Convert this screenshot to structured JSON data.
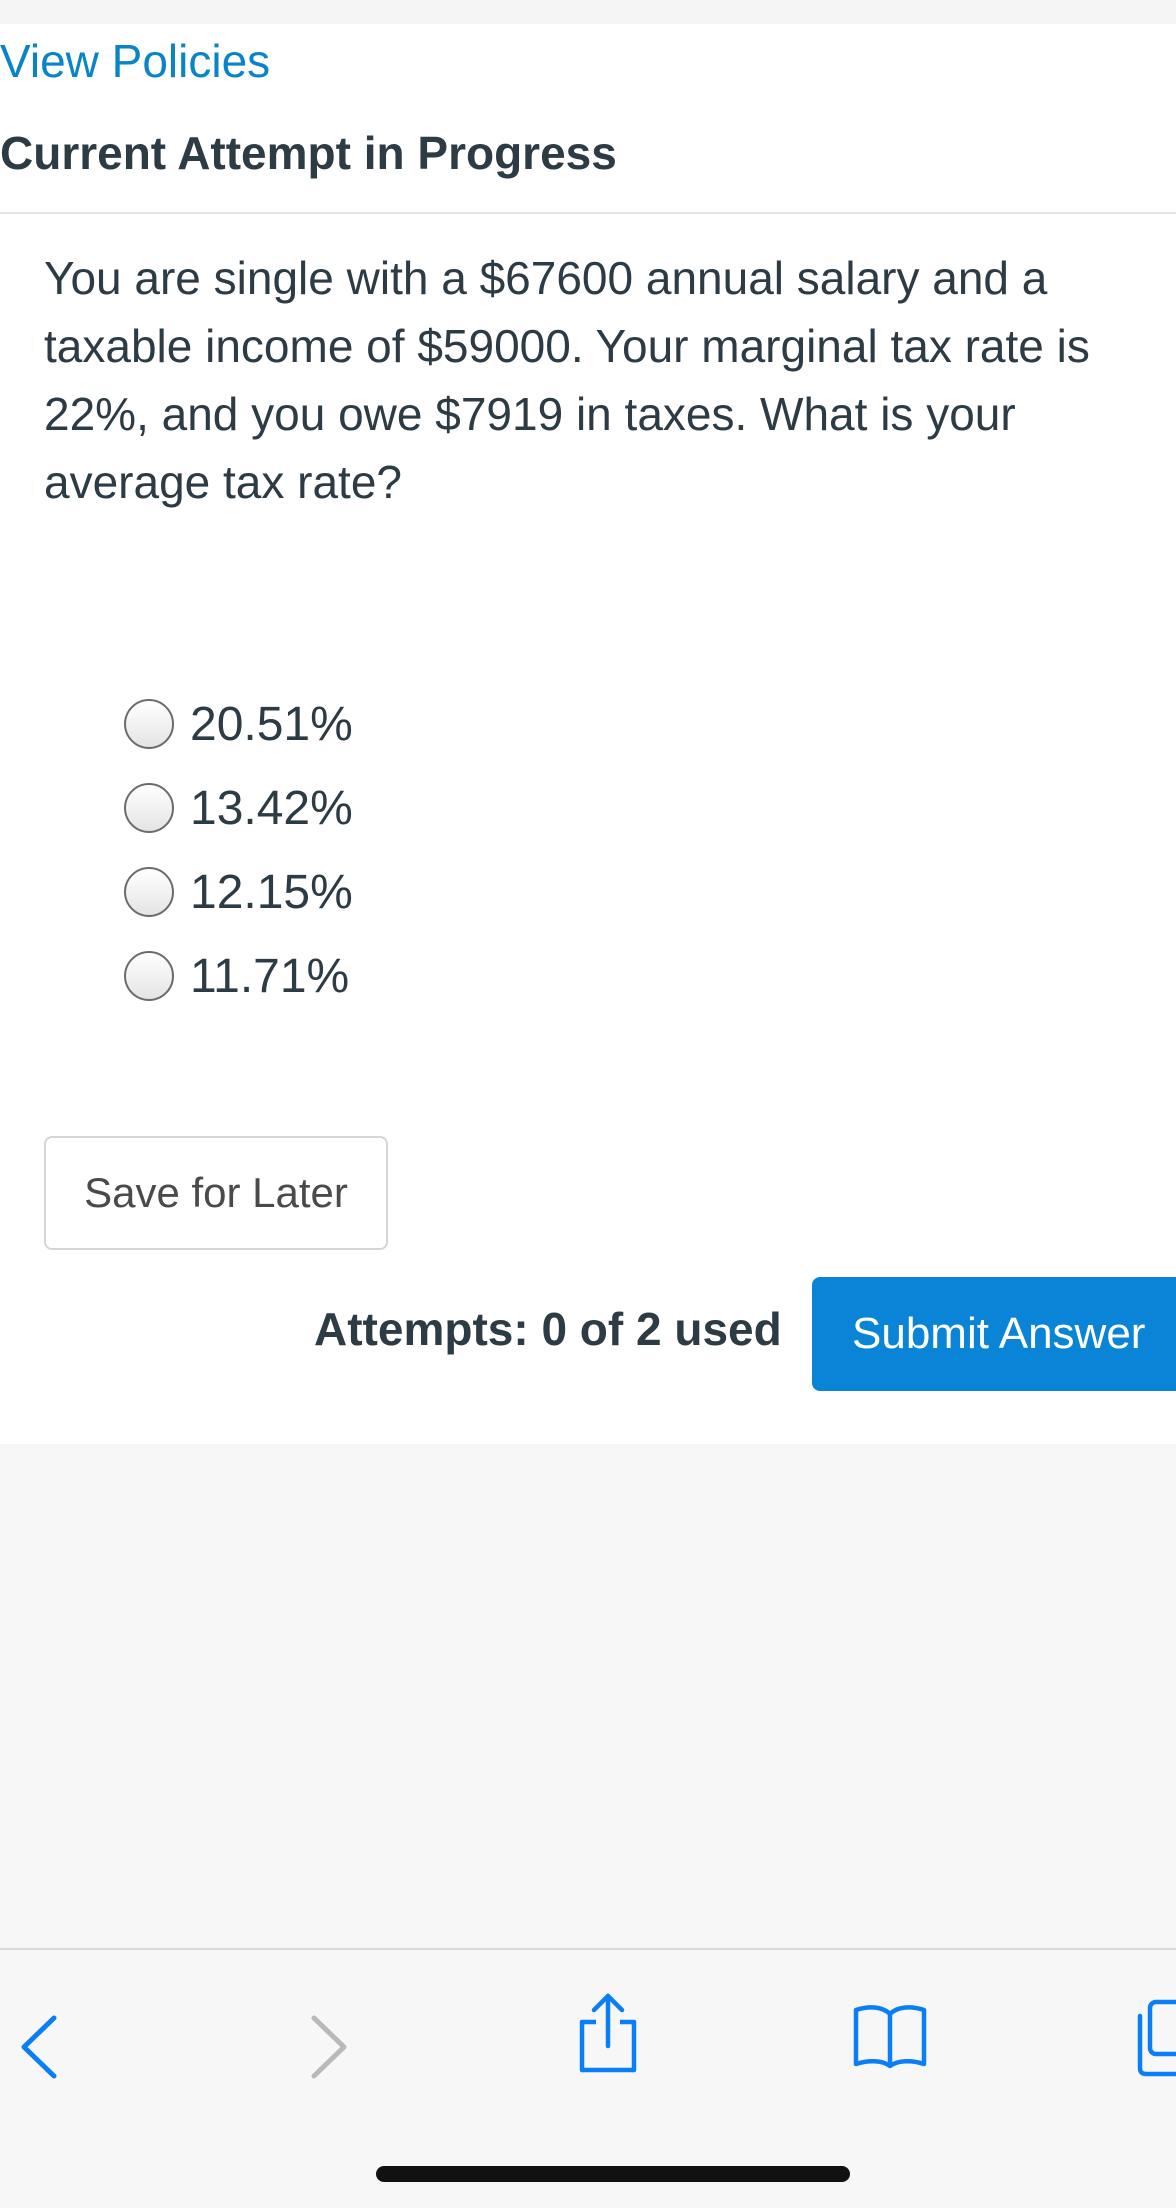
{
  "header": {
    "view_policies_label": "View Policies",
    "attempt_title": "Current Attempt in Progress"
  },
  "question": {
    "text": "You are single with a $67600 annual salary and a taxable income of $59000. Your marginal tax rate is 22%, and you owe $7919 in taxes. What is your average tax rate?"
  },
  "options": [
    {
      "label": "20.51%",
      "selected": false
    },
    {
      "label": "13.42%",
      "selected": false
    },
    {
      "label": "12.15%",
      "selected": false
    },
    {
      "label": "11.71%",
      "selected": false
    }
  ],
  "actions": {
    "save_label": "Save for Later",
    "attempts_text": "Attempts: 0 of 2 used",
    "submit_label": "Submit Answer"
  },
  "toolbar": {
    "icons": [
      "back-icon",
      "forward-icon",
      "share-icon",
      "bookmarks-icon",
      "tabs-icon"
    ]
  },
  "colors": {
    "link": "#0a84c6",
    "primary_button": "#0a84d6",
    "text": "#2d3b45",
    "page_background": "#f7f7f7"
  }
}
